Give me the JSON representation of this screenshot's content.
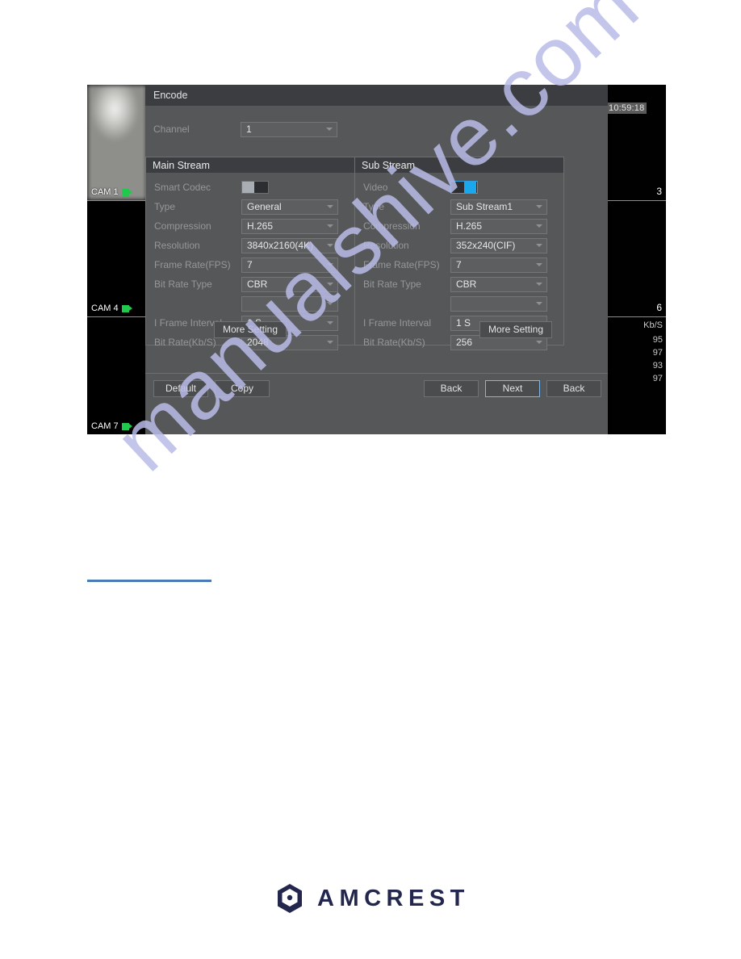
{
  "dialog": {
    "title": "Encode",
    "channel": {
      "label": "Channel",
      "value": "1"
    },
    "main_stream": {
      "header": "Main Stream",
      "rows": [
        {
          "label": "Smart Codec",
          "type": "toggle",
          "state": "off",
          "value": ""
        },
        {
          "label": "Type",
          "type": "select",
          "value": "General"
        },
        {
          "label": "Compression",
          "type": "select",
          "value": "H.265"
        },
        {
          "label": "Resolution",
          "type": "select",
          "value": "3840x2160(4K)"
        },
        {
          "label": "Frame Rate(FPS)",
          "type": "select",
          "value": "7"
        },
        {
          "label": "Bit Rate Type",
          "type": "select",
          "value": "CBR"
        },
        {
          "label": "",
          "type": "select-disabled",
          "value": ""
        },
        {
          "label": "I Frame Interval",
          "type": "select",
          "value": "1 S"
        },
        {
          "label": "Bit Rate(Kb/S)",
          "type": "select",
          "value": "2048"
        }
      ],
      "more_setting": "More Setting"
    },
    "sub_stream": {
      "header": "Sub Stream",
      "rows": [
        {
          "label": "Video",
          "type": "toggle",
          "state": "on",
          "value": ""
        },
        {
          "label": "Type",
          "type": "select",
          "value": "Sub Stream1"
        },
        {
          "label": "Compression",
          "type": "select",
          "value": "H.265"
        },
        {
          "label": "Resolution",
          "type": "select",
          "value": "352x240(CIF)"
        },
        {
          "label": "Frame Rate(FPS)",
          "type": "select",
          "value": "7"
        },
        {
          "label": "Bit Rate Type",
          "type": "select",
          "value": "CBR"
        },
        {
          "label": "",
          "type": "select-disabled",
          "value": ""
        },
        {
          "label": "I Frame Interval",
          "type": "select",
          "value": "1 S"
        },
        {
          "label": "Bit Rate(Kb/S)",
          "type": "select",
          "value": "256"
        }
      ],
      "more_setting": "More Setting"
    },
    "footer": {
      "default_label": "Default",
      "copy_label": "Copy",
      "back_label": "Back",
      "next_label": "Next",
      "back2_label": "Back"
    }
  },
  "left_panes": [
    {
      "label": "CAM 1",
      "icon": "camera-icon"
    },
    {
      "label": "CAM 4",
      "icon": "camera-icon"
    },
    {
      "label": "CAM 7",
      "icon": "camera-icon"
    }
  ],
  "right_panes": {
    "timestamp": "10:59:18",
    "pane1_number": "3",
    "pane2_number": "6",
    "kbs_header": "Kb/S",
    "kbs_values": [
      "95",
      "97",
      "93",
      "97"
    ]
  },
  "watermark": {
    "text": "manualshive.com"
  },
  "branding": {
    "wordmark": "AMCREST"
  },
  "colors": {
    "dialog_bg": "#555759",
    "titlebar_bg": "#3b3d40",
    "accent_blue": "#19a8ee",
    "focus_blue": "#7fb6e8",
    "rule_blue": "#4a79b8",
    "cam_icon_green": "#1ec94b",
    "logo_navy": "#23264d",
    "watermark": "#b9bbe8"
  }
}
